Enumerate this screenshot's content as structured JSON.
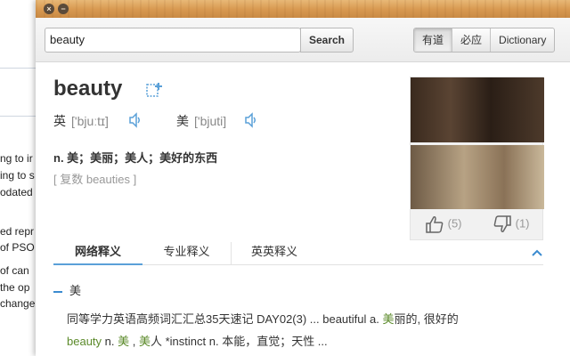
{
  "background_doc": {
    "fragments": [
      "ng to ir",
      "ing to s",
      "odated a",
      "ed repr",
      "of PSO",
      "of can",
      "the op",
      "change"
    ]
  },
  "titlebar": {
    "close_symbol": "×",
    "minimize_symbol": "−"
  },
  "search": {
    "value": "beauty",
    "button_label": "Search"
  },
  "dict_tabs": [
    "有道",
    "必应",
    "Dictionary"
  ],
  "entry": {
    "headword": "beauty",
    "phonetics": [
      {
        "label": "英",
        "ipa": "['bjuːtɪ]"
      },
      {
        "label": "美",
        "ipa": "['bjuti]"
      }
    ],
    "definition": "n. 美；美丽；美人；美好的东西",
    "plural": "[ 复数 beauties ]"
  },
  "images": {
    "upvotes": "(5)",
    "downvotes": "(1)"
  },
  "meaning_tabs": [
    "网络释义",
    "专业释义",
    "英英释义"
  ],
  "web_meaning": {
    "sense": "美",
    "line1_a": "同等学力英语高频词汇汇总35天速记 DAY02(3) ... beautiful a. ",
    "line1_hl": "美",
    "line1_b": "丽的, 很好的",
    "line2_hl1": "beauty",
    "line2_a": " n. ",
    "line2_hl2": "美",
    "line2_b": " , ",
    "line2_hl3": "美",
    "line2_c": "人 *instinct n. 本能，直觉；天性 ..."
  },
  "colors": {
    "accent": "#5aa0d8",
    "highlight": "#5b8a2a",
    "titlebar": "#d99a52"
  }
}
